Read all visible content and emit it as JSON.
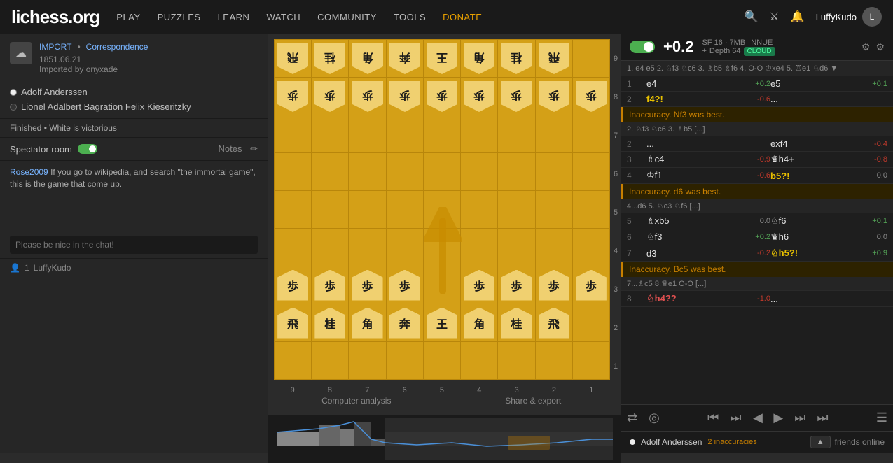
{
  "logo": "lichess.org",
  "nav": {
    "items": [
      "PLAY",
      "PUZZLES",
      "LEARN",
      "WATCH",
      "COMMUNITY",
      "TOOLS"
    ],
    "donate": "DONATE",
    "username": "LuffyKudo"
  },
  "game": {
    "import_label": "IMPORT",
    "type": "Correspondence",
    "date": "1851.06.21",
    "imported_by": "Imported by onyxade",
    "player_white": "Adolf Anderssen",
    "player_black": "Lionel Adalbert Bagration Felix Kieseritzky",
    "result": "Finished • White is victorious"
  },
  "chat": {
    "spectator_room": "Spectator room",
    "notes": "Notes",
    "message_user": "Rose2009",
    "message_text": "If you go to wikipedia, and search \"the immortal game\", this is the game that come up.",
    "input_placeholder": "Please be nice in the chat!",
    "online_count": "1",
    "online_user": "LuffyKudo"
  },
  "engine": {
    "eval": "+0.2",
    "sf_label": "SF 16 · 7MB",
    "nnue_label": "NNUE",
    "depth_label": "Depth 64",
    "cloud_label": "CLOUD"
  },
  "moves_line": "1. e4 e5 2. ♘f3 ♘c6 3. ♗b5 ♗f6 4. O-O ♔xe4 5. ♖e1 ♘d6 ▼",
  "analysis": {
    "moves": [
      {
        "num": "1",
        "white": "e4",
        "white_score": "+0.2",
        "black": "e5",
        "black_score": "+0.1",
        "white_class": "move-score-pos",
        "black_class": "move-score-pos"
      },
      {
        "num": "2",
        "white": "f4?!",
        "white_score": "-0.6",
        "black": "...",
        "black_score": "",
        "white_class": "move-score-neg move-special",
        "black_class": ""
      }
    ],
    "inaccuracy1": "Inaccuracy. Nf3 was best.",
    "inaccuracy1_line": "2. ♘f3 ♘c6 3. ♗b5 [...]",
    "moves2": [
      {
        "num": "2",
        "white": "...",
        "white_score": "",
        "black": "exf4",
        "black_score": "-0.4",
        "white_class": "",
        "black_class": "move-score-neg"
      },
      {
        "num": "3",
        "white": "♗c4",
        "white_score": "-0.9",
        "black": "♛h4+",
        "black_score": "-0.8",
        "white_class": "move-score-neg",
        "black_class": "move-score-neg"
      },
      {
        "num": "4",
        "white": "♔f1",
        "white_score": "-0.6",
        "black": "b5?!",
        "black_score": "0.0",
        "white_class": "move-score-neg",
        "black_class": "move-score-neu move-special"
      }
    ],
    "inaccuracy2": "Inaccuracy. d6 was best.",
    "inaccuracy2_line": "4...d6 5. ♘c3 ♘f6 [...]",
    "moves3": [
      {
        "num": "5",
        "white": "♗xb5",
        "white_score": "0.0",
        "black": "♘f6",
        "black_score": "+0.1",
        "white_class": "move-score-neu",
        "black_class": "move-score-pos"
      },
      {
        "num": "6",
        "white": "♘f3",
        "white_score": "+0.2",
        "black": "♛h6",
        "black_score": "0.0",
        "white_class": "move-score-pos",
        "black_class": "move-score-neu"
      },
      {
        "num": "7",
        "white": "d3",
        "white_score": "-0.2",
        "black": "♘h5?!",
        "black_score": "+0.9",
        "white_class": "move-score-neg",
        "black_class": "move-score-pos move-special"
      }
    ],
    "inaccuracy3": "Inaccuracy. Bc5 was best.",
    "inaccuracy3_line": "7...♗c5 8.♛e1 O-O [...]",
    "moves4": [
      {
        "num": "8",
        "white": "♘h4??",
        "white_score": "-1.0",
        "black": "...",
        "black_score": "",
        "white_class": "move-score-neg move-blunder",
        "black_class": ""
      }
    ]
  },
  "controls": {
    "first": "⏮",
    "prev_chapter": "⏭",
    "prev": "◀",
    "next": "▶",
    "next_chapter": "⏭",
    "last": "⏭",
    "menu": "☰"
  },
  "bottom": {
    "player": "Adolf Anderssen",
    "inaccuracy_count": "2",
    "inaccuracy_label": "inaccuracies",
    "friends_label": "friends online"
  },
  "board_labels": {
    "rows": [
      "9",
      "8",
      "7",
      "6",
      "5",
      "4",
      "3",
      "2",
      "1"
    ],
    "cols": [
      "9",
      "8",
      "7",
      "6",
      "5",
      "4",
      "3",
      "2",
      "1"
    ]
  },
  "board": {
    "pieces": [
      [
        "飛",
        "桂",
        "角",
        "奔",
        "王",
        "角",
        "桂",
        "飛",
        ""
      ],
      [
        "歩",
        "歩",
        "歩",
        "歩",
        "歩",
        "歩",
        "歩",
        "歩",
        ""
      ],
      [
        "",
        "",
        "",
        "",
        "",
        "",
        "",
        "",
        ""
      ],
      [
        "",
        "",
        "",
        "",
        "↑",
        "",
        "",
        "",
        ""
      ],
      [
        "",
        "",
        "",
        "",
        "",
        "",
        "",
        "",
        ""
      ],
      [
        "",
        "",
        "",
        "",
        "",
        "",
        "",
        "",
        "歩"
      ],
      [
        "歩",
        "歩",
        "歩",
        "歩",
        "",
        "歩",
        "歩",
        "歩",
        ""
      ],
      [
        "飛",
        "桂",
        "角",
        "奔",
        "王",
        "角",
        "桂",
        "飛",
        ""
      ]
    ],
    "row1_sente": [
      "飛",
      "桂",
      "角",
      "奔",
      "王",
      "角",
      "桂",
      "飛",
      ""
    ],
    "row2_sente": [
      "歩",
      "歩",
      "歩",
      "歩",
      "歩",
      "歩",
      "歩",
      "歩",
      ""
    ]
  }
}
